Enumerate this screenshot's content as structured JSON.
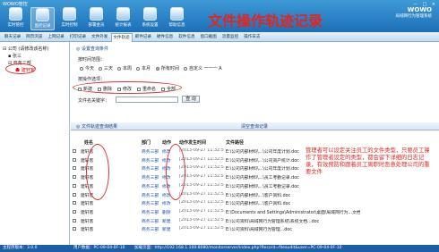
{
  "app": {
    "name": "WOWO管控",
    "window_controls": "－ □ ×"
  },
  "toolbar": [
    {
      "label": "实时管控",
      "selected": false
    },
    {
      "label": "监控记录",
      "selected": true
    },
    {
      "label": "实时控制",
      "selected": false
    },
    {
      "label": "部署金员",
      "selected": false
    },
    {
      "label": "统计报表",
      "selected": false
    },
    {
      "label": "系统设置",
      "selected": false
    },
    {
      "label": "帮助信息",
      "selected": false
    }
  ],
  "banner": "文件操作轨迹记录",
  "brand": {
    "name": "WOWO",
    "tagline": "局域网行为管理系统"
  },
  "tabs": [
    "聊天记录",
    "网页浏览",
    "上网记录",
    "打印记录",
    "文件外发",
    "文件轨迹",
    "邮件记录",
    "硬件信息",
    "软件信息",
    "窗口截图",
    "流量监控",
    "操作日志"
  ],
  "selected_tab": 5,
  "tree": {
    "root": "公司 (请修改该名称)",
    "group1": "张三",
    "group2": "商务三部",
    "leaf": "建轩客"
  },
  "query": {
    "header": "设置查询条件",
    "time_label": "按时间范围：",
    "time_options": [
      "今天",
      "三天",
      "本周",
      "本月",
      "所有时间",
      "自定义 一一一 A"
    ],
    "time_selected": 4,
    "op_label": "按操作选项：",
    "op_options": [
      "新建",
      "删除",
      "修改",
      "重命名",
      "全部"
    ],
    "name_label": "文件名关键字：",
    "name_value": "",
    "search_btn": "查 询"
  },
  "results": {
    "tab_label": "文件轨迹查询结果",
    "clear_label": "清空查询记录"
  },
  "columns": [
    "姓名",
    "部门",
    "动作",
    "动作发生时间",
    "文件路径"
  ],
  "rows": [
    {
      "name": "建轩客",
      "dept": "商务三部",
      "action": "修改",
      "time": "[2013-09-27 11:32:57]",
      "path": "E:\\公司内部材料\\...\\公司年度计划.doc"
    },
    {
      "name": "建轩客",
      "dept": "商务三部",
      "action": "修改",
      "time": "[2013-09-27 11:32:57]",
      "path": "E:\\公司内部材料\\...\\公司资产统计.doc"
    },
    {
      "name": "建轩客",
      "dept": "商务三部",
      "action": "修改",
      "time": "[2013-09-27 11:32:57]",
      "path": "E:\\公司内部材料\\...\\公司年度计划.doc"
    },
    {
      "name": "建轩客",
      "dept": "商务三部",
      "action": "修改",
      "time": "[2013-09-27 11:32:58]",
      "path": "E:\\公司内部材料\\...\\员工考勤记录.doc"
    },
    {
      "name": "建轩客",
      "dept": "商务三部",
      "action": "修改",
      "time": "[2013-09-27 11:32:57]",
      "path": "E:\\公司内部材料\\...\\员工考勤记录.doc"
    },
    {
      "name": "建轩客",
      "dept": "商务三部",
      "action": "修改",
      "time": "[2013-09-27 11:32:57]",
      "path": "E:\\公司内部材料\\...\\客户资料.doc"
    },
    {
      "name": "建轩客",
      "dept": "商务三部",
      "action": "修改",
      "time": "[2013-09-27 11:32:58]",
      "path": "E:\\公司内部材料\\...\\客户资料.doc"
    },
    {
      "name": "建轩客",
      "dept": "商务三部",
      "action": "删除",
      "time": "[2013-09-27 11:32:58]",
      "path": "E:\\Documents and Settings\\Administrator\\桌面\\局域网行为...文档.doc"
    },
    {
      "name": "建轩客",
      "dept": "商务三部",
      "action": "新建",
      "time": "[2013-09-27 11:32:58]",
      "path": "E:\\公司资料\\局域网行为管理系统\\系统文档...doc"
    },
    {
      "name": "建轩客",
      "dept": "商务三部",
      "action": "新建",
      "time": "[2013-09-27 11:32:58]",
      "path": "E:\\公司资料\\局域网行为管理...doc"
    }
  ],
  "annotation": "管理者可以设定关注员工的文件类型，只要员工操作了管理者设定的类型，都会留下详细的日志记录，有效预防和跟着员工离职时恶意处理公司的重要文件",
  "status": {
    "version": "主程序版本：3.0.0",
    "users": "用户数据：PC-09-04-0F-10",
    "update": "加载页面：http://192.168.1.100:8080/monitorserver/index.php?Record=fileaudit&user=PC-09-04-0F-10"
  }
}
